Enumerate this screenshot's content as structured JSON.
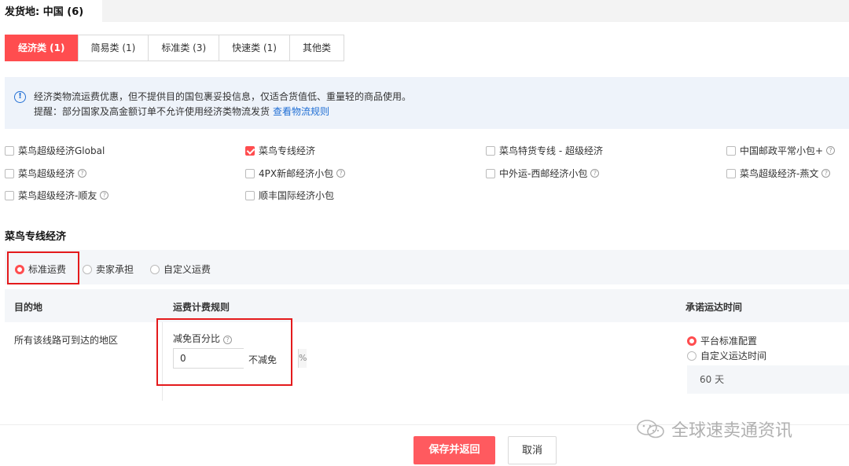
{
  "header": {
    "origin": "发货地:  中国 (6)"
  },
  "tabs": [
    {
      "label": "经济类 (1)",
      "active": true
    },
    {
      "label": "简易类 (1)",
      "active": false
    },
    {
      "label": "标准类 (3)",
      "active": false
    },
    {
      "label": "快速类 (1)",
      "active": false
    },
    {
      "label": "其他类",
      "active": false
    }
  ],
  "info": {
    "line1": "经济类物流运费优惠，但不提供目的国包裹妥投信息，仅适合货值低、重量轻的商品使用。",
    "line2": "提醒：部分国家及高金额订单不允许使用经济类物流发货",
    "link": "查看物流规则"
  },
  "options": [
    {
      "label": "菜鸟超级经济Global",
      "checked": false,
      "help": false
    },
    {
      "label": "菜鸟专线经济",
      "checked": true,
      "help": false
    },
    {
      "label": "菜鸟特货专线 - 超级经济",
      "checked": false,
      "help": false
    },
    {
      "label": "中国邮政平常小包+",
      "checked": false,
      "help": true
    },
    {
      "label": "菜鸟超级经济",
      "checked": false,
      "help": true
    },
    {
      "label": "4PX新邮经济小包",
      "checked": false,
      "help": true
    },
    {
      "label": "中外运-西邮经济小包",
      "checked": false,
      "help": true
    },
    {
      "label": "菜鸟超级经济-燕文",
      "checked": false,
      "help": true
    },
    {
      "label": "菜鸟超级经济-顺友",
      "checked": false,
      "help": true
    },
    {
      "label": "顺丰国际经济小包",
      "checked": false,
      "help": false
    }
  ],
  "section": {
    "title": "菜鸟专线经济",
    "radios": [
      {
        "label": "标准运费",
        "selected": true
      },
      {
        "label": "卖家承担",
        "selected": false
      },
      {
        "label": "自定义运费",
        "selected": false
      }
    ]
  },
  "table": {
    "headers": {
      "dest": "目的地",
      "rule": "运费计费规则",
      "time": "承诺运达时间"
    },
    "row": {
      "dest": "所有该线路可到达的地区",
      "discount_label": "减免百分比",
      "discount_value": "0",
      "discount_suffix": "%",
      "no_discount": "不减免",
      "time_options": [
        {
          "label": "平台标准配置",
          "selected": true
        },
        {
          "label": "自定义运达时间",
          "selected": false
        }
      ],
      "days": "60 天"
    }
  },
  "footer": {
    "save": "保存并返回",
    "cancel": "取消"
  },
  "watermark": "全球速卖通资讯",
  "colors": {
    "accent": "#ff4d4f",
    "link": "#1f6ed4",
    "highlight": "#e41a1c"
  }
}
